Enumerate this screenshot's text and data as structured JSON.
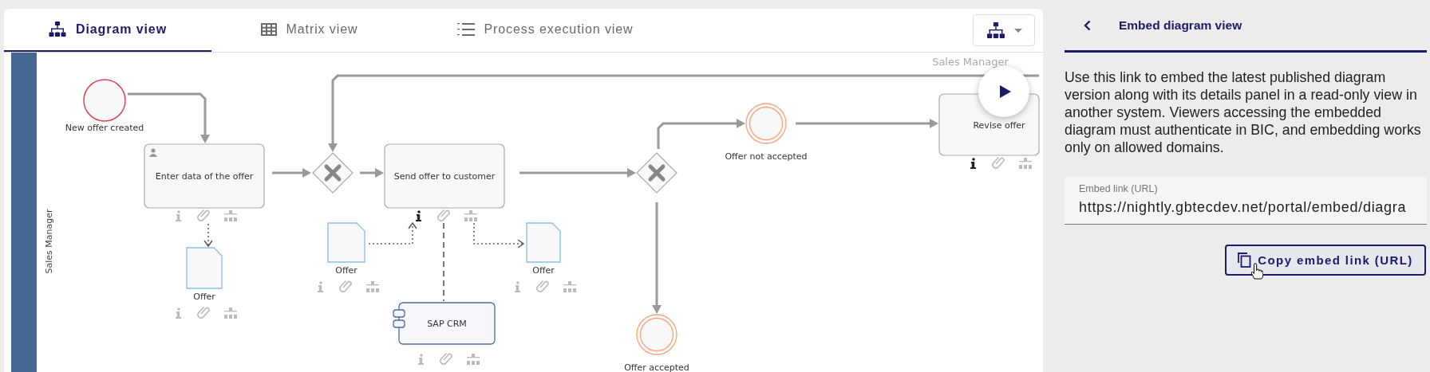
{
  "tabs": [
    {
      "label": "Diagram view",
      "selected": true
    },
    {
      "label": "Matrix view",
      "selected": false
    },
    {
      "label": "Process execution view",
      "selected": false
    }
  ],
  "diagram": {
    "lane_label": "Sales Manager",
    "top_label": "Sales Manager",
    "nodes": [
      {
        "kind": "start_event",
        "label": "New offer created"
      },
      {
        "kind": "task",
        "label": "Enter data of the offer",
        "performer": true,
        "info_active": false
      },
      {
        "kind": "gateway"
      },
      {
        "kind": "task",
        "label": "Send offer to customer",
        "performer": false,
        "info_active": true
      },
      {
        "kind": "gateway"
      },
      {
        "kind": "intermediate_event",
        "label": "Offer not accepted"
      },
      {
        "kind": "task",
        "label": "Revise offer",
        "performer": false,
        "info_active": true
      },
      {
        "kind": "data_object",
        "label": "Offer",
        "info_active": false
      },
      {
        "kind": "data_object",
        "label": "Offer",
        "info_active": false
      },
      {
        "kind": "data_object",
        "label": "Offer",
        "info_active": false
      },
      {
        "kind": "system",
        "label": "SAP CRM",
        "info_active": false
      },
      {
        "kind": "intermediate_event",
        "label": "Offer accepted"
      }
    ]
  },
  "panel": {
    "title": "Embed diagram view",
    "description": "Use this link to embed the latest published diagram version along with its details panel in a read-only view in another system. Viewers accessing the embedded diagram must authenticate in BIC, and embedding works only on allowed domains.",
    "field": {
      "label": "Embed link (URL)",
      "value": "https://nightly.gbtecdev.net/portal/embed/diagra"
    },
    "button": "Copy embed link (URL)"
  }
}
